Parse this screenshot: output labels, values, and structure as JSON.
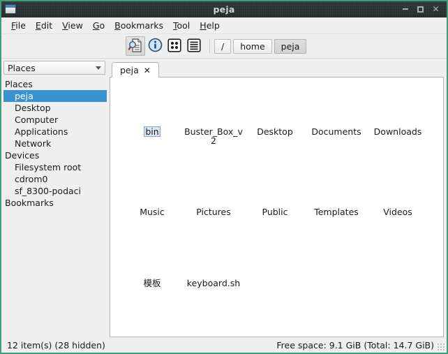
{
  "window": {
    "title": "peja",
    "icon": "window-icon",
    "controls": {
      "minimize": "−",
      "maximize": "□",
      "close": "✕"
    }
  },
  "menubar": {
    "items": [
      {
        "accel": "F",
        "rest": "ile"
      },
      {
        "accel": "E",
        "rest": "dit"
      },
      {
        "accel": "V",
        "rest": "iew"
      },
      {
        "accel": "G",
        "rest": "o"
      },
      {
        "accel": "B",
        "rest": "ookmarks"
      },
      {
        "accel": "T",
        "rest": "ool"
      },
      {
        "accel": "H",
        "rest": "elp"
      }
    ]
  },
  "toolbar": {
    "buttons": [
      {
        "name": "find-files-icon",
        "label": ""
      },
      {
        "name": "info-icon",
        "label": ""
      },
      {
        "name": "icon-view-icon",
        "label": ""
      },
      {
        "name": "list-view-icon",
        "label": ""
      }
    ],
    "path_buttons": [
      {
        "label": "/",
        "current": false
      },
      {
        "label": "home",
        "current": false
      },
      {
        "label": "peja",
        "current": true
      }
    ]
  },
  "sidebar": {
    "combo_value": "Places",
    "entries": [
      {
        "label": "Places",
        "type": "group",
        "selected": false
      },
      {
        "label": "peja",
        "type": "item",
        "selected": true
      },
      {
        "label": "Desktop",
        "type": "item",
        "selected": false
      },
      {
        "label": "Computer",
        "type": "item",
        "selected": false
      },
      {
        "label": "Applications",
        "type": "item",
        "selected": false
      },
      {
        "label": "Network",
        "type": "item",
        "selected": false
      },
      {
        "label": "Devices",
        "type": "group",
        "selected": false
      },
      {
        "label": "Filesystem root",
        "type": "item",
        "selected": false
      },
      {
        "label": "cdrom0",
        "type": "item",
        "selected": false
      },
      {
        "label": "sf_8300-podaci",
        "type": "item",
        "selected": false
      },
      {
        "label": "Bookmarks",
        "type": "group",
        "selected": false
      }
    ]
  },
  "tabs": [
    {
      "label": "peja",
      "close": "✕"
    }
  ],
  "files": {
    "rows": [
      [
        {
          "label": "bin",
          "selected": true
        },
        {
          "label": "Buster_Box_v2",
          "selected": false
        },
        {
          "label": "Desktop",
          "selected": false
        },
        {
          "label": "Documents",
          "selected": false
        },
        {
          "label": "Downloads",
          "selected": false
        }
      ],
      [
        {
          "label": "Music",
          "selected": false
        },
        {
          "label": "Pictures",
          "selected": false
        },
        {
          "label": "Public",
          "selected": false
        },
        {
          "label": "Templates",
          "selected": false
        },
        {
          "label": "Videos",
          "selected": false
        }
      ],
      [
        {
          "label": "模板",
          "selected": false
        },
        {
          "label": "keyboard.sh",
          "selected": false
        }
      ]
    ]
  },
  "statusbar": {
    "left": "12 item(s) (28 hidden)",
    "right": "Free space: 9.1 GiB (Total: 14.7 GiB)"
  },
  "colors": {
    "selection_blue": "#3a93d0",
    "frame_green": "#3f9e79",
    "titlebar_dark": "#2b3133"
  }
}
